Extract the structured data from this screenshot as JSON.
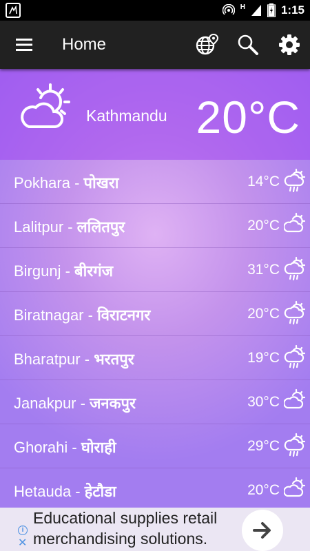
{
  "status_bar": {
    "time": "1:15",
    "network": "H"
  },
  "toolbar": {
    "title": "Home",
    "icons": [
      "menu-icon",
      "globe-pin-icon",
      "search-icon",
      "gear-icon"
    ]
  },
  "current": {
    "city": "Kathmandu",
    "temp": "20°C",
    "icon": "partly-cloudy-icon"
  },
  "cities": [
    {
      "en": "Pokhara",
      "sep": " - ",
      "ne": "पोखरा",
      "temp": "14°C",
      "icon": "rain-icon"
    },
    {
      "en": "Lalitpur",
      "sep": " - ",
      "ne": "ललितपुर",
      "temp": "20°C",
      "icon": "partly-cloudy-icon"
    },
    {
      "en": "Birgunj",
      "sep": " - ",
      "ne": "बीरगंज",
      "temp": "31°C",
      "icon": "rain-icon"
    },
    {
      "en": "Biratnagar",
      "sep": " - ",
      "ne": "विराटनगर",
      "temp": "20°C",
      "icon": "rain-icon"
    },
    {
      "en": "Bharatpur",
      "sep": " - ",
      "ne": "भरतपुर",
      "temp": "19°C",
      "icon": "rain-icon"
    },
    {
      "en": "Janakpur",
      "sep": " - ",
      "ne": "जनकपुर",
      "temp": "30°C",
      "icon": "partly-cloudy-icon"
    },
    {
      "en": "Ghorahi",
      "sep": " - ",
      "ne": "घोराही",
      "temp": "29°C",
      "icon": "rain-icon"
    },
    {
      "en": "Hetauda",
      "sep": " - ",
      "ne": "हेटौडा",
      "temp": "20°C",
      "icon": "partly-cloudy-icon"
    }
  ],
  "ad": {
    "text": "Educational supplies retail merchandising solutions.",
    "info": "i",
    "close": "✕"
  },
  "colors": {
    "toolbar": "#212121",
    "header_band": "#a046f0",
    "list_bg": "#c493ec",
    "accent_blue": "#4a90e2"
  }
}
